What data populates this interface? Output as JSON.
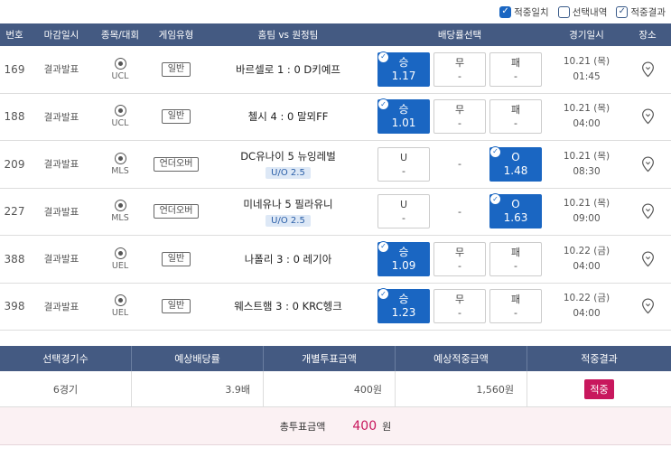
{
  "filters": [
    {
      "label": "적중일치",
      "state": "checked"
    },
    {
      "label": "선택내역",
      "state": "unchecked"
    },
    {
      "label": "적중결과",
      "state": "outline"
    }
  ],
  "columns": [
    "번호",
    "마감일시",
    "종목/대회",
    "게임유형",
    "홈팀 vs 원정팀",
    "배당률선택",
    "경기일시",
    "장소"
  ],
  "rows": [
    {
      "no": "169",
      "status": "결과발표",
      "league": "UCL",
      "type": "일반",
      "match": "바르셀로 1 : 0 D키예프",
      "uo": "",
      "odds": [
        {
          "label": "승",
          "val": "1.17",
          "sel": true
        },
        {
          "label": "무",
          "val": "-",
          "sel": false
        },
        {
          "label": "패",
          "val": "-",
          "sel": false
        }
      ],
      "date": "10.21 (목)",
      "time": "01:45"
    },
    {
      "no": "188",
      "status": "결과발표",
      "league": "UCL",
      "type": "일반",
      "match": "첼시 4 : 0 말뫼FF",
      "uo": "",
      "odds": [
        {
          "label": "승",
          "val": "1.01",
          "sel": true
        },
        {
          "label": "무",
          "val": "-",
          "sel": false
        },
        {
          "label": "패",
          "val": "-",
          "sel": false
        }
      ],
      "date": "10.21 (목)",
      "time": "04:00"
    },
    {
      "no": "209",
      "status": "결과발표",
      "league": "MLS",
      "type": "언더오버",
      "match": "DC유나이   5   뉴잉레벌",
      "uo": "U/O 2.5",
      "odds": [
        {
          "label": "U",
          "val": "-",
          "sel": false
        },
        {
          "label": "",
          "val": "-",
          "sel": false,
          "plain": true
        },
        {
          "label": "O",
          "val": "1.48",
          "sel": true
        }
      ],
      "date": "10.21 (목)",
      "time": "08:30"
    },
    {
      "no": "227",
      "status": "결과발표",
      "league": "MLS",
      "type": "언더오버",
      "match": "미네유나   5   필라유니",
      "uo": "U/O 2.5",
      "odds": [
        {
          "label": "U",
          "val": "-",
          "sel": false
        },
        {
          "label": "",
          "val": "-",
          "sel": false,
          "plain": true
        },
        {
          "label": "O",
          "val": "1.63",
          "sel": true
        }
      ],
      "date": "10.21 (목)",
      "time": "09:00"
    },
    {
      "no": "388",
      "status": "결과발표",
      "league": "UEL",
      "type": "일반",
      "match": "나폴리 3 : 0 레기아",
      "uo": "",
      "odds": [
        {
          "label": "승",
          "val": "1.09",
          "sel": true
        },
        {
          "label": "무",
          "val": "-",
          "sel": false
        },
        {
          "label": "패",
          "val": "-",
          "sel": false
        }
      ],
      "date": "10.22 (금)",
      "time": "04:00"
    },
    {
      "no": "398",
      "status": "결과발표",
      "league": "UEL",
      "type": "일반",
      "match": "웨스트햄 3 : 0 KRC헹크",
      "uo": "",
      "odds": [
        {
          "label": "승",
          "val": "1.23",
          "sel": true
        },
        {
          "label": "무",
          "val": "-",
          "sel": false
        },
        {
          "label": "패",
          "val": "-",
          "sel": false
        }
      ],
      "date": "10.22 (금)",
      "time": "04:00"
    }
  ],
  "summary": {
    "headers": [
      "선택경기수",
      "예상배당률",
      "개별투표금액",
      "예상적중금액",
      "적중결과"
    ],
    "values": [
      "6경기",
      "3.9배",
      "400원",
      "1,560원",
      "적중"
    ]
  },
  "total": {
    "label": "총투표금액",
    "amount": "400",
    "unit": "원"
  },
  "colors": {
    "header": "#445a82",
    "selected": "#1a66c2",
    "hit": "#c8175d"
  }
}
